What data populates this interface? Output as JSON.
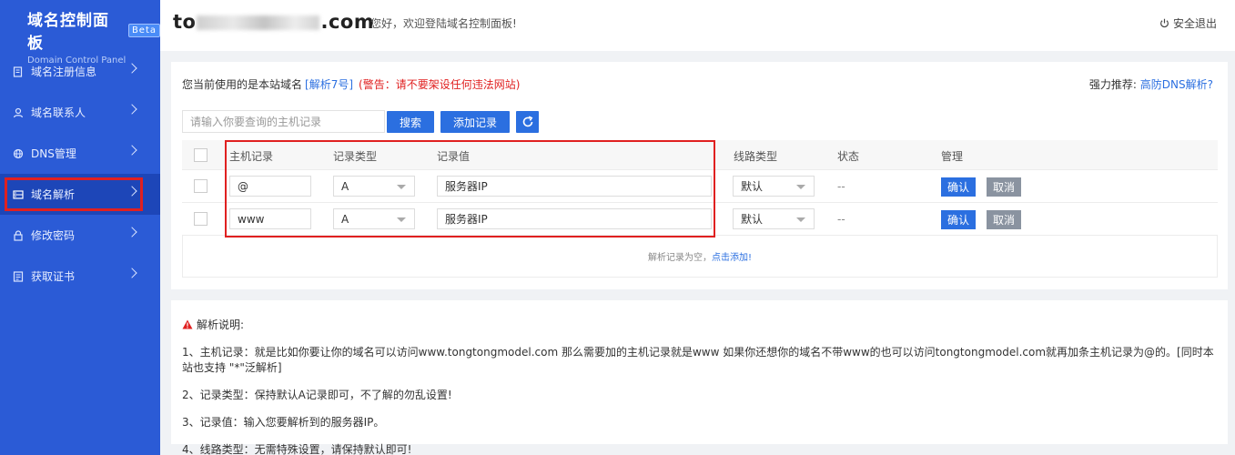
{
  "sidebar": {
    "brand_title": "域名控制面板",
    "brand_badge": "Beta",
    "brand_subtitle": "Domain Control Panel",
    "items": [
      {
        "label": "域名注册信息",
        "icon": "document-icon"
      },
      {
        "label": "域名联系人",
        "icon": "user-icon"
      },
      {
        "label": "DNS管理",
        "icon": "globe-icon"
      },
      {
        "label": "域名解析",
        "icon": "server-icon",
        "active": true
      },
      {
        "label": "修改密码",
        "icon": "lock-icon"
      },
      {
        "label": "获取证书",
        "icon": "certificate-icon"
      }
    ]
  },
  "header": {
    "domain_prefix": "to",
    "domain_suffix": ".com",
    "welcome": "您好，欢迎登陆域名控制面板!",
    "logout": "安全退出"
  },
  "notice": {
    "text": "您当前使用的是本站域名",
    "link": "[解析7号]",
    "warning": "(警告：请不要架设任何违法网站)",
    "recommend_label": "强力推荐:",
    "recommend_link": "高防DNS解析?"
  },
  "toolbar": {
    "search_placeholder": "请输入你要查询的主机记录",
    "search_button": "搜索",
    "add_button": "添加记录"
  },
  "table": {
    "headers": {
      "host": "主机记录",
      "type": "记录类型",
      "value": "记录值",
      "line": "线路类型",
      "status": "状态",
      "manage": "管理"
    },
    "rows": [
      {
        "host": "@",
        "type": "A",
        "value": "服务器IP",
        "line": "默认",
        "status": "--",
        "confirm": "确认",
        "cancel": "取消"
      },
      {
        "host": "www",
        "type": "A",
        "value": "服务器IP",
        "line": "默认",
        "status": "--",
        "confirm": "确认",
        "cancel": "取消"
      }
    ],
    "empty_text": "解析记录为空，",
    "empty_link": "点击添加!"
  },
  "explain": {
    "title": "解析说明:",
    "lines": [
      "1、主机记录：就是比如你要让你的域名可以访问www.tongtongmodel.com 那么需要加的主机记录就是www 如果你还想你的域名不带www的也可以访问tongtongmodel.com就再加条主机记录为@的。[同时本站也支持 \"*\"泛解析]",
      "2、记录类型：保持默认A记录即可，不了解的勿乱设置!",
      "3、记录值：输入您要解析到的服务器IP。",
      "4、线路类型：无需特殊设置，请保持默认即可!"
    ]
  },
  "colors": {
    "sidebar": "#2b5bd6",
    "primary": "#2b6fe0",
    "warning": "#e02020",
    "annotation_box": "#e02020"
  }
}
